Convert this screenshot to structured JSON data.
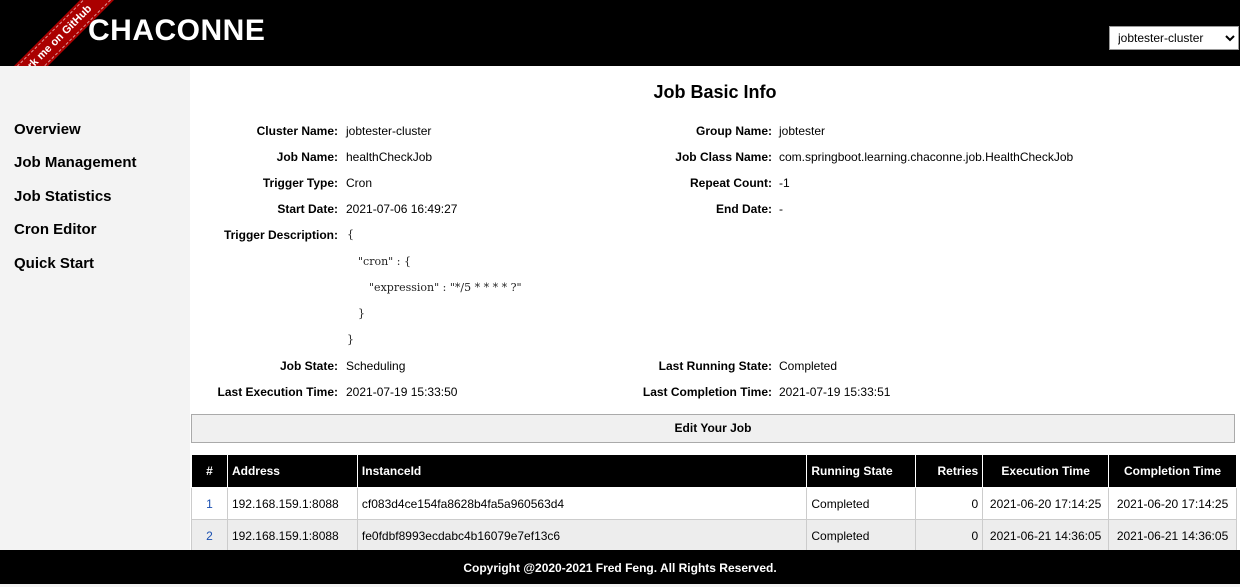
{
  "header": {
    "brand": "CHACONNE",
    "ribbon": "Fork me on GitHub",
    "cluster_select": {
      "selected": "jobtester-cluster",
      "options": [
        "jobtester-cluster"
      ]
    }
  },
  "sidebar": {
    "items": [
      {
        "label": "Overview"
      },
      {
        "label": "Job Management"
      },
      {
        "label": "Job Statistics"
      },
      {
        "label": "Cron Editor"
      },
      {
        "label": "Quick Start"
      }
    ]
  },
  "main": {
    "title": "Job Basic Info",
    "info": {
      "cluster_name": {
        "label": "Cluster Name:",
        "value": "jobtester-cluster"
      },
      "group_name": {
        "label": "Group Name:",
        "value": "jobtester"
      },
      "job_name": {
        "label": "Job Name:",
        "value": "healthCheckJob"
      },
      "job_class_name": {
        "label": "Job Class Name:",
        "value": "com.springboot.learning.chaconne.job.HealthCheckJob"
      },
      "trigger_type": {
        "label": "Trigger Type:",
        "value": "Cron"
      },
      "repeat_count": {
        "label": "Repeat Count:",
        "value": "-1"
      },
      "start_date": {
        "label": "Start Date:",
        "value": "2021-07-06 16:49:27"
      },
      "end_date": {
        "label": "End Date:",
        "value": "-"
      },
      "trigger_description": {
        "label": "Trigger Description:",
        "lines": [
          "{",
          "\"cron\" : {",
          "\"expression\" : \"*/5 * * * * ?\"",
          "}",
          "}"
        ]
      },
      "job_state": {
        "label": "Job State:",
        "value": "Scheduling"
      },
      "last_running_state": {
        "label": "Last Running State:",
        "value": "Completed"
      },
      "last_execution_time": {
        "label": "Last Execution Time:",
        "value": "2021-07-19 15:33:50"
      },
      "last_completion_time": {
        "label": "Last Completion Time:",
        "value": "2021-07-19 15:33:51"
      }
    },
    "edit_button": "Edit Your Job",
    "table": {
      "headers": [
        "#",
        "Address",
        "InstanceId",
        "Running State",
        "Retries",
        "Execution Time",
        "Completion Time"
      ],
      "rows": [
        [
          "1",
          "192.168.159.1:8088",
          "cf083d4ce154fa8628b4fa5a960563d4",
          "Completed",
          "0",
          "2021-06-20 17:14:25",
          "2021-06-20 17:14:25"
        ],
        [
          "2",
          "192.168.159.1:8088",
          "fe0fdbf8993ecdabc4b16079e7ef13c6",
          "Completed",
          "0",
          "2021-06-21 14:36:05",
          "2021-06-21 14:36:05"
        ]
      ]
    }
  },
  "footer": {
    "text": "Copyright @2020-2021 Fred Feng. All Rights Reserved."
  }
}
